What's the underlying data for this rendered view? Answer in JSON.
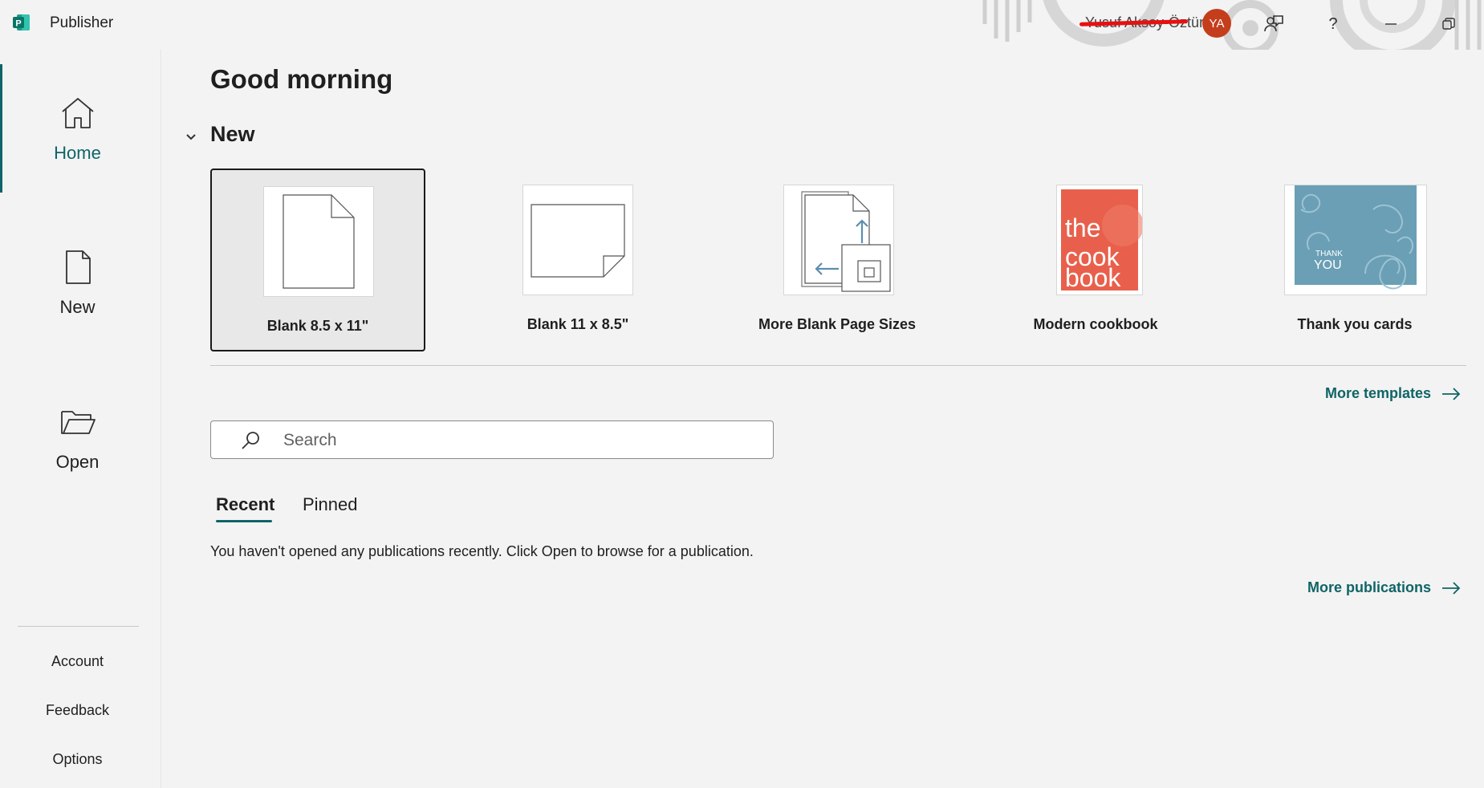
{
  "app": {
    "name": "Publisher",
    "icon": "publisher-logo-icon"
  },
  "titlebar": {
    "user_name": "Yusuf Aksoy-Öztürk",
    "avatar_initials": "YA",
    "avatar_color": "#c43e1c",
    "buttons": [
      "feedback-icon",
      "help-icon",
      "minimize-icon",
      "restore-icon"
    ]
  },
  "sidebar": {
    "items": [
      {
        "label": "Home",
        "icon": "home-icon",
        "active": true
      },
      {
        "label": "New",
        "icon": "new-document-icon",
        "active": false
      },
      {
        "label": "Open",
        "icon": "folder-open-icon",
        "active": false
      }
    ],
    "footer": [
      {
        "label": "Account"
      },
      {
        "label": "Feedback"
      },
      {
        "label": "Options"
      }
    ]
  },
  "main": {
    "greeting": "Good morning",
    "new_section": {
      "title": "New",
      "templates": [
        {
          "label": "Blank 8.5 x 11\"",
          "selected": true
        },
        {
          "label": "Blank 11 x 8.5\"",
          "selected": false
        },
        {
          "label": "More Blank Page Sizes",
          "selected": false
        },
        {
          "label": "Modern cookbook",
          "selected": false,
          "thumb_text": "the cook book"
        },
        {
          "label": "Thank you cards",
          "selected": false,
          "thumb_text": "THANK YOU"
        }
      ],
      "more_templates": "More templates"
    },
    "search": {
      "placeholder": "Search",
      "value": ""
    },
    "tabs": [
      {
        "label": "Recent",
        "active": true
      },
      {
        "label": "Pinned",
        "active": false
      }
    ],
    "empty_message": "You haven't opened any publications recently. Click Open to browse for a publication.",
    "more_publications": "More publications"
  },
  "colors": {
    "accent": "#0f6467",
    "background": "#f3f3f3",
    "cookbook_red": "#e8604c",
    "thankyou_blue": "#6a9fb5"
  }
}
